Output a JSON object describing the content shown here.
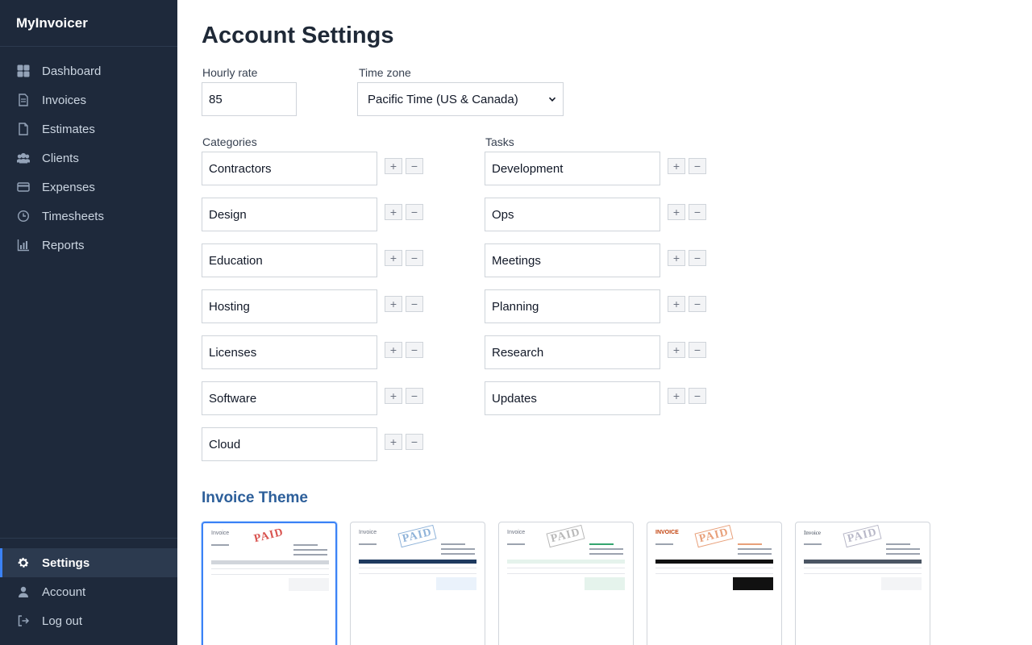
{
  "app": {
    "name": "MyInvoicer"
  },
  "sidebar": {
    "items": [
      {
        "label": "Dashboard",
        "icon": "dashboard-icon"
      },
      {
        "label": "Invoices",
        "icon": "invoice-document-icon"
      },
      {
        "label": "Estimates",
        "icon": "estimate-document-icon"
      },
      {
        "label": "Clients",
        "icon": "users-icon"
      },
      {
        "label": "Expenses",
        "icon": "credit-card-icon"
      },
      {
        "label": "Timesheets",
        "icon": "clock-icon"
      },
      {
        "label": "Reports",
        "icon": "bar-chart-icon"
      }
    ],
    "bottom_items": [
      {
        "label": "Settings",
        "icon": "gear-icon",
        "active": true
      },
      {
        "label": "Account",
        "icon": "user-icon"
      },
      {
        "label": "Log out",
        "icon": "logout-icon"
      }
    ]
  },
  "page": {
    "title": "Account Settings",
    "hourly_rate": {
      "label": "Hourly rate",
      "value": "85"
    },
    "time_zone": {
      "label": "Time zone",
      "value": "Pacific Time (US & Canada)"
    },
    "categories": {
      "label": "Categories",
      "items": [
        "Contractors",
        "Design",
        "Education",
        "Hosting",
        "Licenses",
        "Software",
        "Cloud"
      ]
    },
    "tasks": {
      "label": "Tasks",
      "items": [
        "Development",
        "Ops",
        "Meetings",
        "Planning",
        "Research",
        "Updates"
      ]
    },
    "add_symbol": "+",
    "remove_symbol": "−",
    "invoice_theme": {
      "title": "Invoice Theme",
      "themes": [
        {
          "heading": "Invoice",
          "stamp": "PAID",
          "accent": "#d9534f",
          "header_color": "#d1d5db",
          "selected": true
        },
        {
          "heading": "Invoice",
          "stamp": "PAID",
          "accent": "#8fb3d9",
          "header_color": "#1e3a5f",
          "selected": false
        },
        {
          "heading": "Invoice",
          "stamp": "PAID",
          "accent": "#b8b8b8",
          "header_color": "#e5f3ec",
          "selected": false
        },
        {
          "heading": "INVOICE",
          "stamp": "PAID",
          "accent": "#e8a07a",
          "header_color": "#111111",
          "selected": false
        },
        {
          "heading": "Invoice",
          "stamp": "PAID",
          "accent": "#b8b8c8",
          "header_color": "#4b5563",
          "selected": false
        }
      ]
    }
  },
  "colors": {
    "sidebar_bg": "#1e293b",
    "accent": "#3b82f6",
    "section_title": "#2d5f9a"
  }
}
